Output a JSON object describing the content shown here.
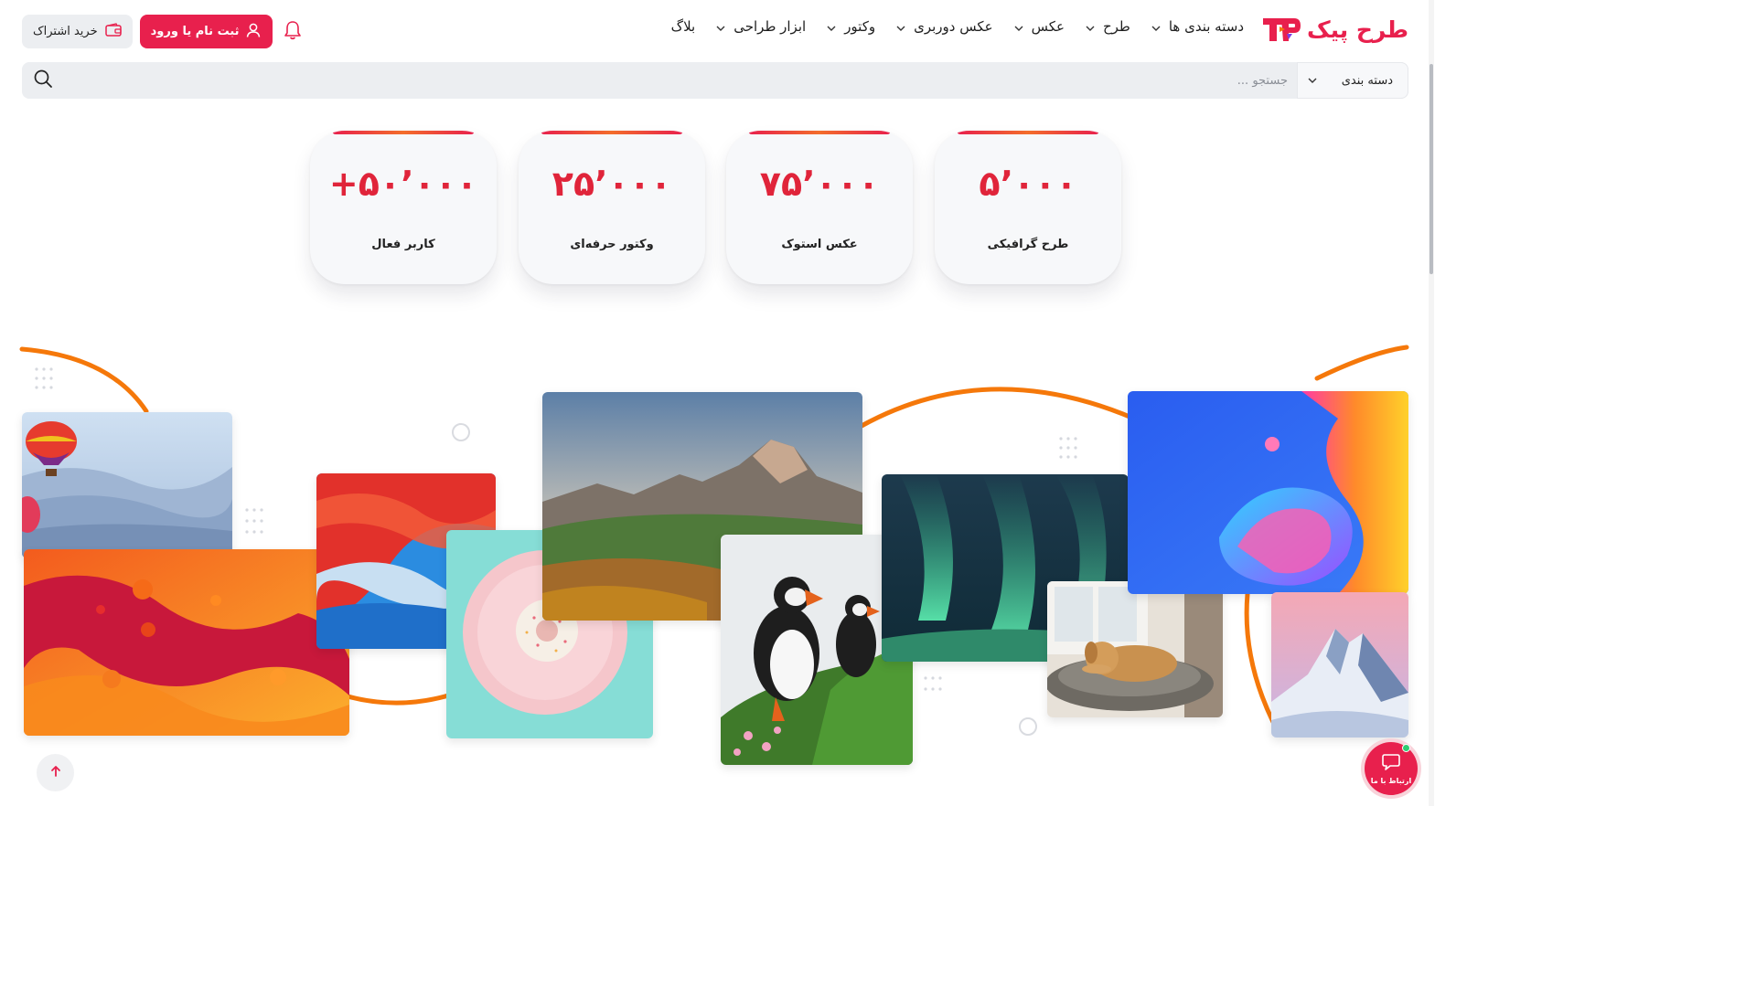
{
  "brand": {
    "name": "طرح پیک",
    "accent": "#e8204d"
  },
  "nav": {
    "items": [
      {
        "label": "دسته بندی ها",
        "has_dropdown": true
      },
      {
        "label": "طرح",
        "has_dropdown": true
      },
      {
        "label": "عکس",
        "has_dropdown": true
      },
      {
        "label": "عکس دوربری",
        "has_dropdown": true
      },
      {
        "label": "وکتور",
        "has_dropdown": true
      },
      {
        "label": "ابزار طراحی",
        "has_dropdown": true
      },
      {
        "label": "بلاگ",
        "has_dropdown": false
      }
    ]
  },
  "header": {
    "login_label": "ثبت نام یا ورود",
    "subscribe_label": "خرید اشتراک",
    "icons": {
      "bell": "bell-icon",
      "user": "user-icon",
      "wallet": "wallet-icon"
    }
  },
  "search": {
    "category_label": "دسته بندی",
    "placeholder": "جستجو ...",
    "value": ""
  },
  "stats": [
    {
      "value": "۵٬۰۰۰",
      "label": "طرح گرافیکی"
    },
    {
      "value": "۷۵٬۰۰۰",
      "label": "عکس استوک"
    },
    {
      "value": "۲۵٬۰۰۰",
      "label": "وکتور حرفه‌ای"
    },
    {
      "value": "+۵۰٬۰۰۰",
      "label": "کاربر فعال"
    }
  ],
  "gallery": {
    "tiles": [
      "hot-air-balloons-photo",
      "orange-fluid-abstract",
      "red-blue-swirl-abstract",
      "donut-plate-photo",
      "mountain-landscape-photo",
      "puffins-photo",
      "aurora-photo",
      "dog-on-bed-photo",
      "colorful-3d-shape-art",
      "snowy-peak-photo"
    ]
  },
  "chat": {
    "label": "ارتباط با ما"
  },
  "colors": {
    "accent": "#e8204d",
    "orange": "#f5780a",
    "surface": "#eceef1"
  }
}
